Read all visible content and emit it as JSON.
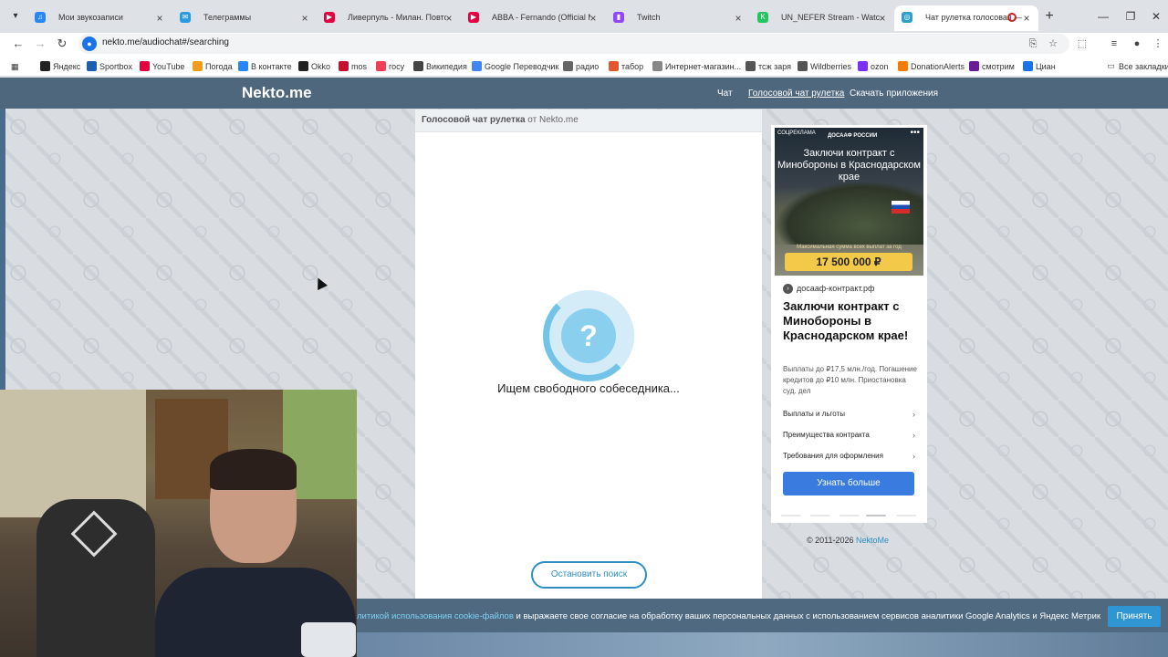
{
  "tabs": [
    {
      "title": "Мои звукозаписи",
      "icon": "vk-audio-icon",
      "color": "#2787f5",
      "glyph": "♫",
      "active": false
    },
    {
      "title": "Телеграммы",
      "icon": "messenger-icon",
      "color": "#2a9ae2",
      "glyph": "✉",
      "active": false
    },
    {
      "title": "Ливерпуль - Милан. Повтор &",
      "icon": "youtube-icon",
      "color": "#e3003e",
      "glyph": "▶",
      "active": false
    },
    {
      "title": "ABBA - Fernando (Official Mus",
      "icon": "youtube-icon",
      "color": "#e3003e",
      "glyph": "▶",
      "active": false
    },
    {
      "title": "Twitch",
      "icon": "twitch-icon",
      "color": "#9146ff",
      "glyph": "▮",
      "active": false
    },
    {
      "title": "UN_NEFER Stream - Watch Live",
      "icon": "kick-icon",
      "color": "#22c55e",
      "glyph": "K",
      "active": false
    },
    {
      "title": "Чат рулетка голосовая —",
      "icon": "nekto-icon",
      "color": "#2fa0c8",
      "glyph": "◎",
      "active": true
    }
  ],
  "address": {
    "url": "nekto.me/audiochat#/searching"
  },
  "bookmarks": [
    {
      "label": "Яндекс",
      "icon": "plus-icon",
      "color": "#222"
    },
    {
      "label": "Sportbox",
      "icon": "sportbox-icon",
      "color": "#1a5fb4"
    },
    {
      "label": "YouTube",
      "icon": "youtube-icon",
      "color": "#e3003e"
    },
    {
      "label": "Погода",
      "icon": "weather-icon",
      "color": "#f29b1d"
    },
    {
      "label": "В контакте",
      "icon": "vk-icon",
      "color": "#2787f5"
    },
    {
      "label": "Okko",
      "icon": "okko-icon",
      "color": "#222"
    },
    {
      "label": "mos",
      "icon": "mos-icon",
      "color": "#c8102e"
    },
    {
      "label": "госу",
      "icon": "gosuslugi-icon",
      "color": "#ee3f58"
    },
    {
      "label": "Википедия",
      "icon": "wikipedia-icon",
      "color": "#444"
    },
    {
      "label": "Google Переводчик",
      "icon": "translate-icon",
      "color": "#4285f4"
    },
    {
      "label": "радио",
      "icon": "folder-icon",
      "color": "#666"
    },
    {
      "label": "табор",
      "icon": "tabor-icon",
      "color": "#e4572e"
    },
    {
      "label": "Интернет-магазин...",
      "icon": "shop-icon",
      "color": "#888"
    },
    {
      "label": "тсж заря",
      "icon": "globe-icon",
      "color": "#555"
    },
    {
      "label": "Wildberries",
      "icon": "globe-icon",
      "color": "#555"
    },
    {
      "label": "ozon",
      "icon": "ozon-icon",
      "color": "#7b2ff7"
    },
    {
      "label": "DonationAlerts",
      "icon": "donation-icon",
      "color": "#f57c00"
    },
    {
      "label": "смотрим",
      "icon": "smotrim-icon",
      "color": "#6a1b9a"
    },
    {
      "label": "Циан",
      "icon": "cian-icon",
      "color": "#1a73e8"
    }
  ],
  "bookmarks_all": "Все закладки",
  "site": {
    "logo": "Nekto.me",
    "nav": [
      "Чат",
      "Голосовой чат рулетка",
      "Скачать приложения"
    ]
  },
  "chat": {
    "header_bold": "Голосовой чат рулетка",
    "header_rest": " от Nekto.me",
    "question_mark": "?",
    "status": "Ищем свободного собеседника...",
    "stop_button": "Остановить поиск"
  },
  "ad": {
    "social_label": "СОЦРЕКЛАМА",
    "org": "ДОСААФ РОССИИ",
    "image_headline": "Заключи контракт с Минобороны в Краснодарском крае",
    "sum_label": "Максимальная сумма всех выплат за год",
    "sum": "17 500 000 ₽",
    "domain": "досааф-контракт.рф",
    "title": "Заключи контракт с Минобороны в Краснодарском крае!",
    "description": "Выплаты до ₽17,5 млн./год. Погашение кредитов до ₽10 млн. Приостановка суд. дел",
    "links": [
      "Выплаты и льготы",
      "Преимущества контракта",
      "Требования для оформления"
    ],
    "cta": "Узнать больше"
  },
  "footer": {
    "copyright": "© 2011-2026 ",
    "brand": "NektoMe"
  },
  "cookie": {
    "link_text": "литикой использования cookie-файлов",
    "text": " и выражаете свое согласие на обработку ваших персональных данных с использованием сервисов аналитики Google Analytics и Яндекс Метрика.",
    "accept": "Принять"
  }
}
